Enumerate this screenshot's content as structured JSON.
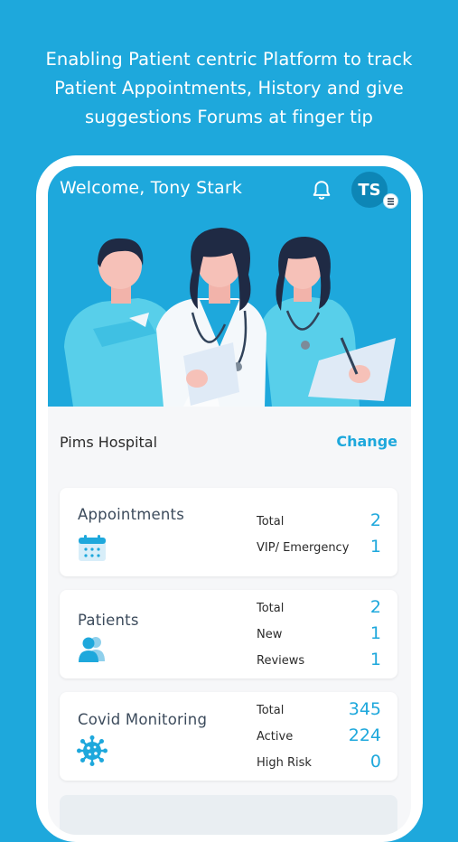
{
  "promo": {
    "lines": [
      "Enabling Patient centric Platform to track",
      "Patient Appointments, History and give",
      "suggestions Forums at finger tip"
    ]
  },
  "header": {
    "welcome": "Welcome, Tony Stark",
    "avatar_initials": "TS"
  },
  "hospital": {
    "name": "Pims Hospital",
    "change_label": "Change"
  },
  "cards": {
    "appointments": {
      "title": "Appointments",
      "icon": "calendar-icon",
      "stats": [
        {
          "label": "Total",
          "value": "2"
        },
        {
          "label": "VIP/ Emergency",
          "value": "1"
        }
      ]
    },
    "patients": {
      "title": "Patients",
      "icon": "users-icon",
      "stats": [
        {
          "label": "Total",
          "value": "2"
        },
        {
          "label": "New",
          "value": "1"
        },
        {
          "label": "Reviews",
          "value": "1"
        }
      ]
    },
    "covid": {
      "title": "Covid Monitoring",
      "icon": "virus-icon",
      "stats": [
        {
          "label": "Total",
          "value": "345"
        },
        {
          "label": "Active",
          "value": "224"
        },
        {
          "label": "High Risk",
          "value": "0"
        }
      ]
    }
  },
  "colors": {
    "brand": "#1ea8dc",
    "title_text": "#3c4b5c"
  }
}
